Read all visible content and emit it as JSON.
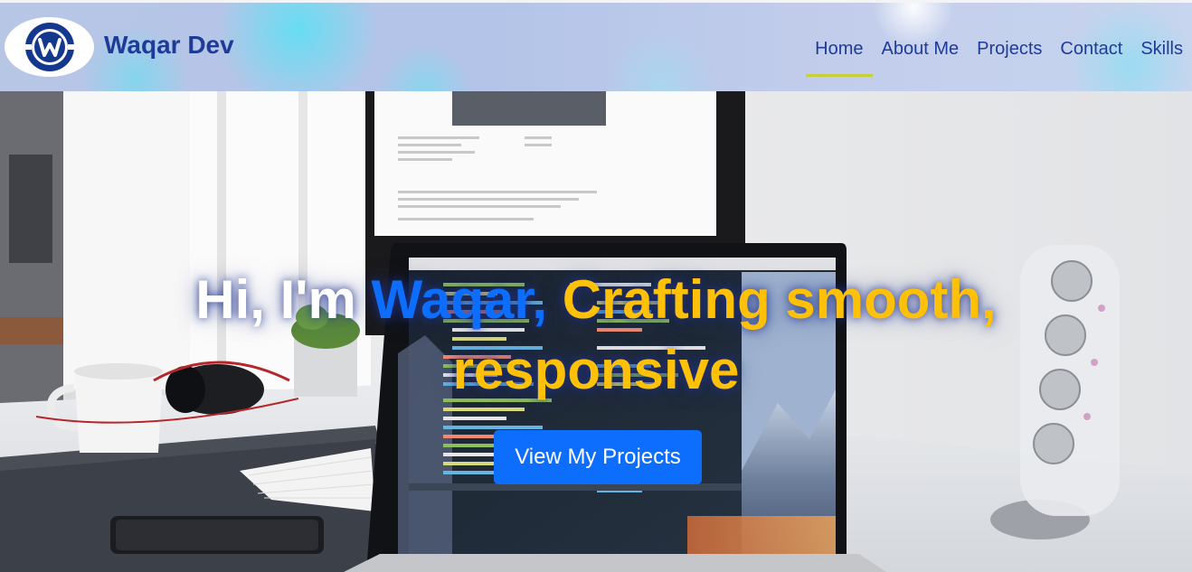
{
  "brand": {
    "name": "Waqar Dev",
    "logo_letter": "W"
  },
  "nav": {
    "items": [
      {
        "label": "Home",
        "active": true
      },
      {
        "label": "About Me",
        "active": false
      },
      {
        "label": "Projects",
        "active": false
      },
      {
        "label": "Contact",
        "active": false
      },
      {
        "label": "Skills",
        "active": false
      }
    ]
  },
  "hero": {
    "greeting": "Hi, I'm",
    "name": "Waqar,",
    "tagline": "Crafting smooth, responsive",
    "cta_label": "View My Projects"
  },
  "colors": {
    "brand_navy": "#1f3b98",
    "accent_blue": "#0d6efd",
    "accent_gold": "#ffc107",
    "nav_underline": "#c6d13a"
  },
  "icons": [
    "waqar-logo-icon",
    "laptop-desk-photo"
  ]
}
